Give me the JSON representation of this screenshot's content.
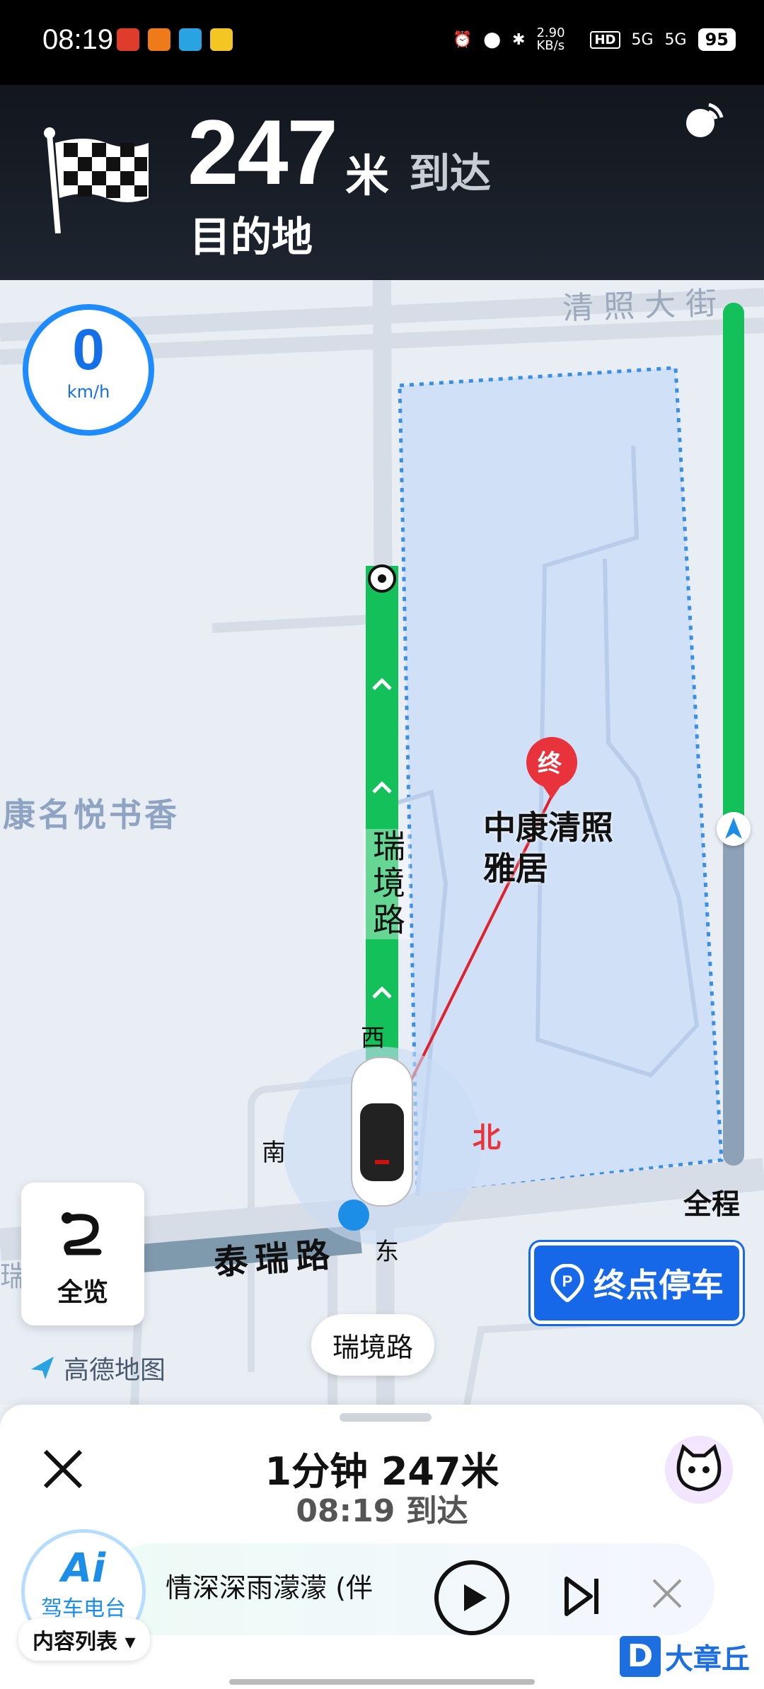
{
  "status": {
    "time": "08:19",
    "net_speed": "2.90 KB/s",
    "signal1": "5G",
    "signal2": "5G",
    "battery": "95"
  },
  "navigation": {
    "distance": "247",
    "unit": "米",
    "arrive_word": "到达",
    "destination": "目的地"
  },
  "map": {
    "speed_value": "0",
    "speed_unit": "km/h",
    "streets": {
      "qingzhao": "清照大街",
      "kangming": "康名悦书香",
      "ruijing_vertical": "瑞境路",
      "tairui": "泰瑞路",
      "rui_left": "瑞"
    },
    "poi_end_badge": "终",
    "poi_name_line1": "中康清照",
    "poi_name_line2": "雅居",
    "compass": {
      "west": "西",
      "south": "南",
      "north": "北",
      "east": "东"
    },
    "progress_label": "全程",
    "progress_fraction": 0.62,
    "overview_label": "全览",
    "parking_label": "终点停车",
    "current_road": "瑞境路",
    "logo_text": "高德地图",
    "route_color": "#13c05a",
    "accent": "#1768e8"
  },
  "bottom": {
    "eta_time_dist": "1分钟   247米",
    "eta_arrival": "08:19 到达",
    "radio": {
      "ai_title": "Ai",
      "ai_subtitle": "驾车电台",
      "song": "情深深雨濛濛 (伴",
      "content_list": "内容列表"
    },
    "watermark": "大章丘"
  }
}
